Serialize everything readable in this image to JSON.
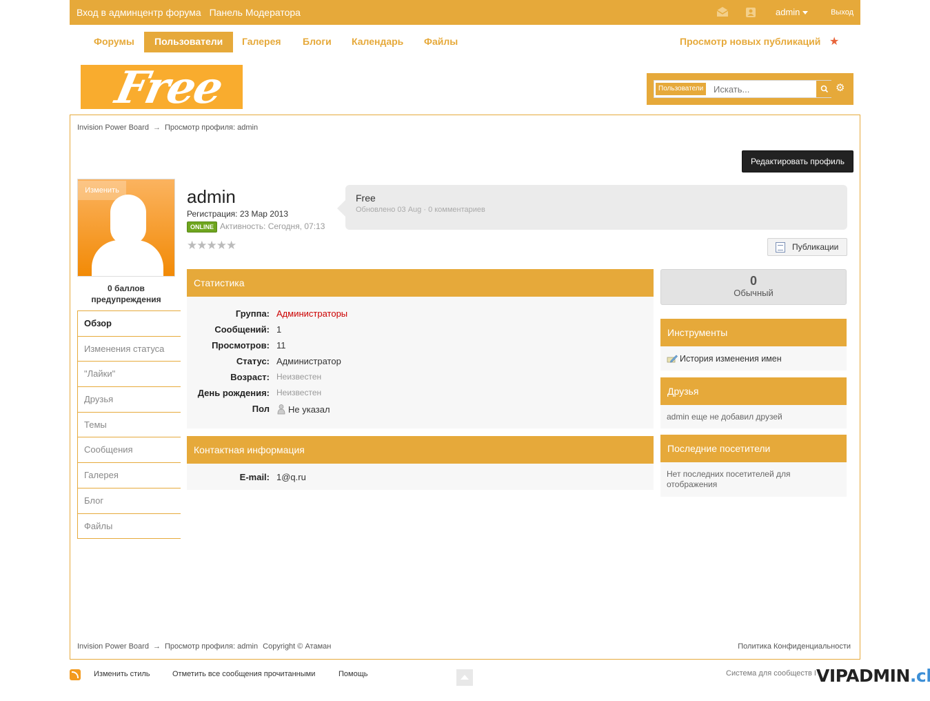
{
  "topbar": {
    "acp_link": "Вход в админцентр форума",
    "modcp_link": "Панель Модератора",
    "username": "admin",
    "logout": "Выход"
  },
  "nav": {
    "items": [
      {
        "label": "Форумы"
      },
      {
        "label": "Пользователи",
        "active": true
      },
      {
        "label": "Галерея"
      },
      {
        "label": "Блоги"
      },
      {
        "label": "Календарь"
      },
      {
        "label": "Файлы"
      }
    ],
    "new_content": "Просмотр новых публикаций",
    "star_icon": "star-icon"
  },
  "logo": {
    "text": "Free"
  },
  "search": {
    "scope": "Пользователи",
    "placeholder": "Искать..."
  },
  "breadcrumb": {
    "root": "Invision Power Board",
    "arrow": "→",
    "current": "Просмотр профиля: admin"
  },
  "edit_profile": "Редактировать профиль",
  "avatar": {
    "change": "Изменить"
  },
  "warnings": "0 баллов предупреждения",
  "side_menu": [
    {
      "label": "Обзор",
      "active": true
    },
    {
      "label": "Изменения статуса"
    },
    {
      "label": "\"Лайки\""
    },
    {
      "label": "Друзья"
    },
    {
      "label": "Темы"
    },
    {
      "label": "Сообщения"
    },
    {
      "label": "Галерея"
    },
    {
      "label": "Блог"
    },
    {
      "label": "Файлы"
    }
  ],
  "profile": {
    "name": "admin",
    "registered": "Регистрация: 23 Мар 2013",
    "online_badge": "ONLINE",
    "activity": "Активность: Сегодня, 07:13",
    "rating_stars": 0
  },
  "status_update": {
    "text": "Free",
    "meta": "Обновлено 03 Aug · 0 комментариев"
  },
  "publications_button": "Публикации",
  "stats": {
    "title": "Статистика",
    "rows": [
      {
        "label": "Группа:",
        "value": "Администраторы"
      },
      {
        "label": "Сообщений:",
        "value": "1"
      },
      {
        "label": "Просмотров:",
        "value": "11"
      },
      {
        "label": "Статус:",
        "value": "Администратор"
      },
      {
        "label": "Возраст:",
        "value": "Неизвестен"
      },
      {
        "label": "День рождения:",
        "value": "Неизвестен"
      },
      {
        "label": "Пол",
        "value": "Не указал"
      }
    ]
  },
  "contact": {
    "title": "Контактная информация",
    "email_label": "E-mail:",
    "email": "1@q.ru"
  },
  "reputation": {
    "value": "0",
    "label": "Обычный"
  },
  "tools": {
    "title": "Инструменты",
    "item": "История изменения имен"
  },
  "friends": {
    "title": "Друзья",
    "text": "admin еще не добавил друзей"
  },
  "visitors": {
    "title": "Последние посетители",
    "text": "Нет последних посетителей для отображения"
  },
  "footer": {
    "root": "Invision Power Board",
    "arrow": "→",
    "current": "Просмотр профиля: admin",
    "copyright": "Copyright © Атаман",
    "privacy": "Политика Конфиденциальности"
  },
  "bottom": {
    "change_style": "Изменить стиль",
    "mark_read": "Отметить все сообщения прочитанными",
    "help": "Помощь",
    "system": "Система для сообществ I"
  },
  "watermark": {
    "main": "VIPADMIN",
    "suffix": ".club"
  },
  "colors": {
    "accent": "#e6a93a",
    "online": "#6ea51e",
    "group_red": "#cc0000"
  }
}
